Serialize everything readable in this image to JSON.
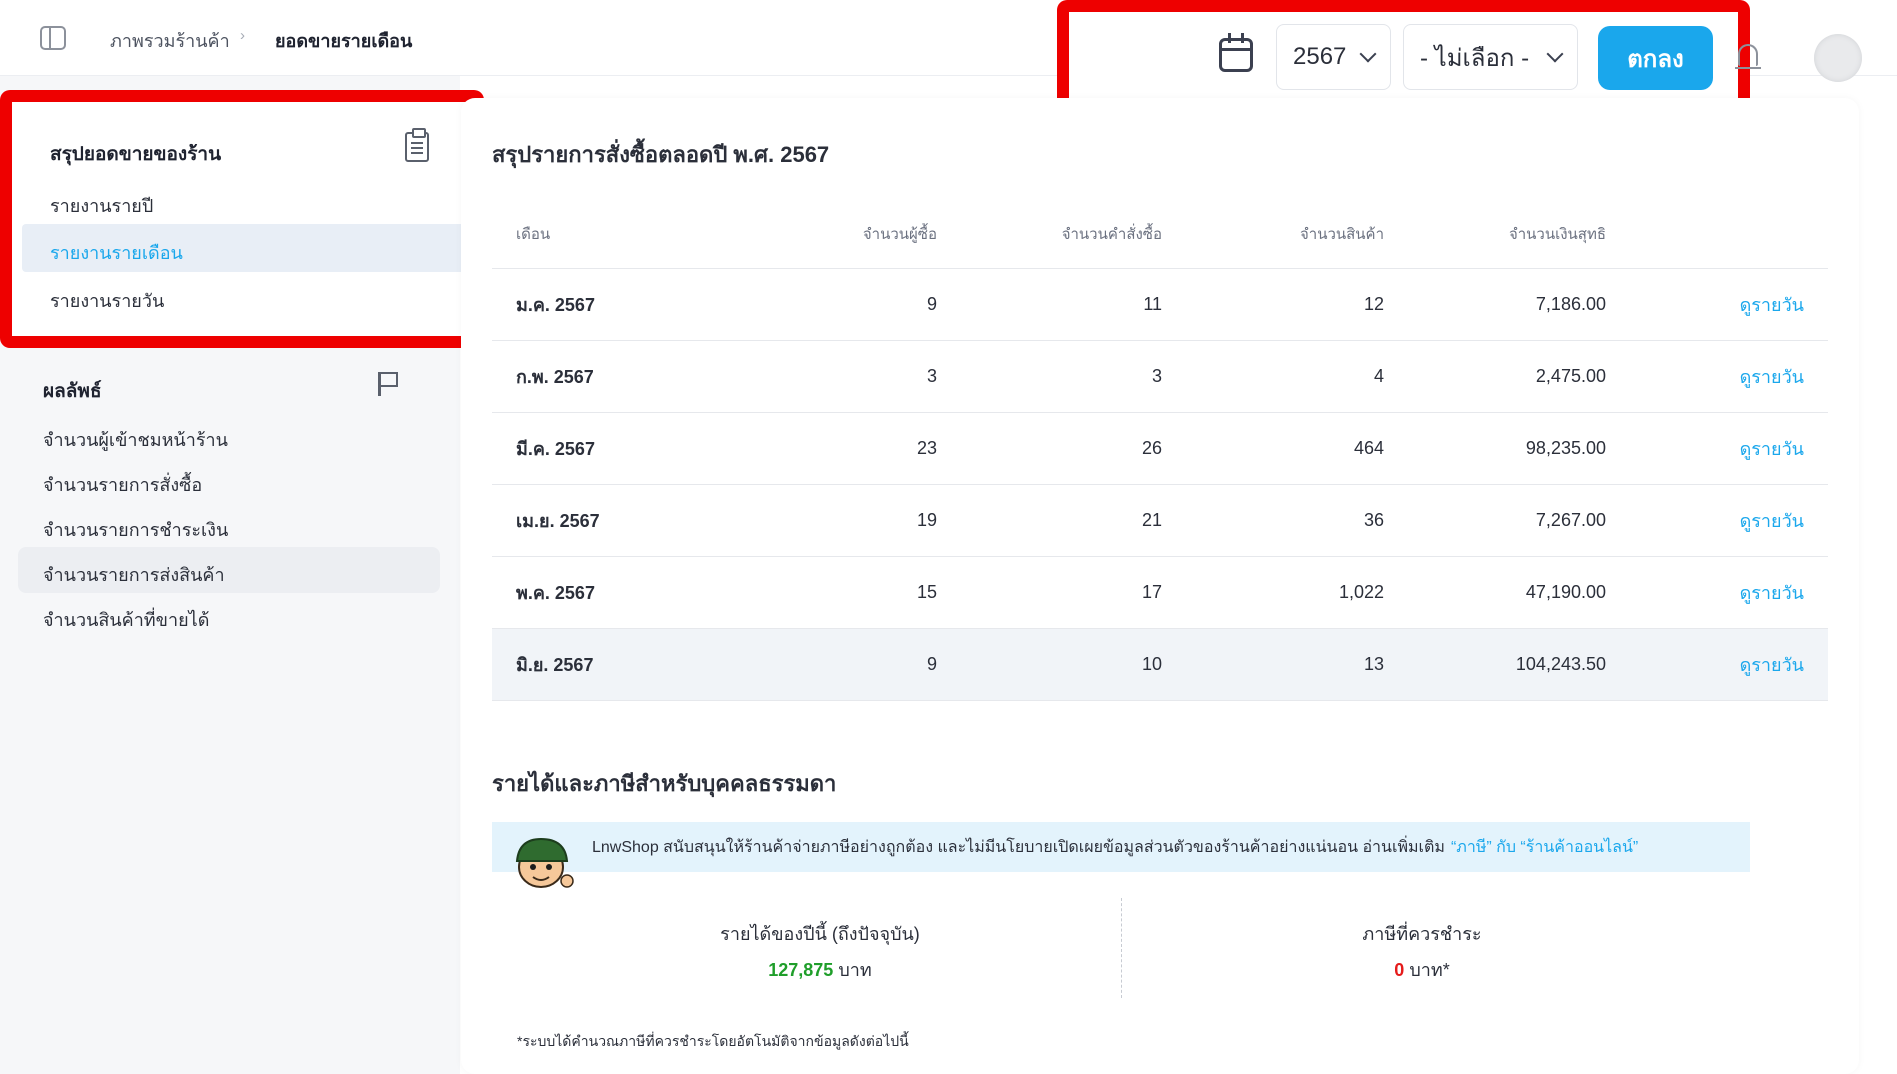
{
  "header": {
    "breadcrumb": [
      "ภาพรวมร้านค้า",
      "ยอดขายรายเดือน"
    ],
    "breadcrumb_sep": "›",
    "year_value": "2567",
    "month_value": "- ไม่เลือก -",
    "ok_label": "ตกลง"
  },
  "sidebar": {
    "group1_title": "สรุปยอดขายของร้าน",
    "group1_items": [
      "รายงานรายปี",
      "รายงานรายเดือน",
      "รายงานรายวัน"
    ],
    "group2_title": "ผลลัพธ์",
    "group2_items": [
      "จำนวนผู้เข้าชมหน้าร้าน",
      "จำนวนรายการสั่งซื้อ",
      "จำนวนรายการชำระเงิน",
      "จำนวนรายการส่งสินค้า",
      "จำนวนสินค้าที่ขายได้"
    ]
  },
  "summary": {
    "title": "สรุปรายการสั่งซื้อตลอดปี พ.ศ. 2567",
    "columns": [
      "เดือน",
      "จำนวนผู้ซื้อ",
      "จำนวนคำสั่งซื้อ",
      "จำนวนสินค้า",
      "จำนวนเงินสุทธิ"
    ],
    "link_label": "ดูรายวัน",
    "rows": [
      {
        "month": "ม.ค. 2567",
        "buyers": "9",
        "orders": "11",
        "items": "12",
        "net": "7,186.00"
      },
      {
        "month": "ก.พ. 2567",
        "buyers": "3",
        "orders": "3",
        "items": "4",
        "net": "2,475.00"
      },
      {
        "month": "มี.ค. 2567",
        "buyers": "23",
        "orders": "26",
        "items": "464",
        "net": "98,235.00"
      },
      {
        "month": "เม.ย. 2567",
        "buyers": "19",
        "orders": "21",
        "items": "36",
        "net": "7,267.00"
      },
      {
        "month": "พ.ค. 2567",
        "buyers": "15",
        "orders": "17",
        "items": "1,022",
        "net": "47,190.00"
      },
      {
        "month": "มิ.ย. 2567",
        "buyers": "9",
        "orders": "10",
        "items": "13",
        "net": "104,243.50"
      }
    ]
  },
  "tax": {
    "title": "รายได้และภาษีสำหรับบุคคลธรรมดา",
    "banner_text": "LnwShop สนับสนุนให้ร้านค้าจ่ายภาษีอย่างถูกต้อง และไม่มีนโยบายเปิดเผยข้อมูลส่วนตัวของร้านค้าอย่างแน่นอน อ่านเพิ่มเติม",
    "banner_link": "“ภาษี” กับ “ร้านค้าออนไลน์”",
    "income_label": "รายได้ของปีนี้ (ถึงปัจจุบัน)",
    "income_value": "127,875",
    "income_unit": "บาท",
    "tax_label": "ภาษีที่ควรชำระ",
    "tax_value": "0",
    "tax_unit": "บาท*",
    "footnote": "*ระบบได้คำนวณภาษีที่ควรชำระโดยอัตโนมัติจากข้อมูลดังต่อไปนี้"
  },
  "colors": {
    "accent": "#1aa7ec",
    "highlight_border": "#ee0000",
    "income_green": "#1f9e2a",
    "tax_red": "#e51b1b"
  }
}
